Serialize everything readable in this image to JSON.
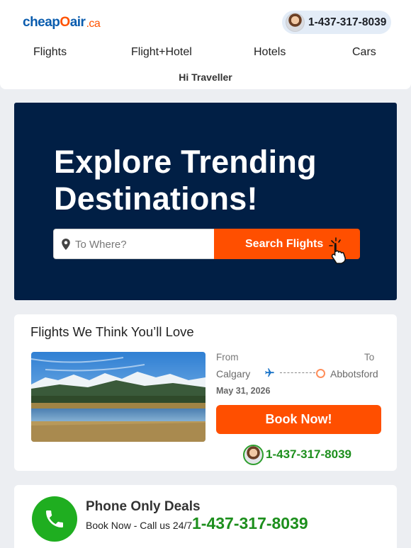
{
  "header": {
    "logo": {
      "part1": "cheap",
      "part2": "O",
      "part3": "air",
      "suffix": ".ca"
    },
    "phone": "1-437-317-8039",
    "nav": [
      "Flights",
      "Flight+Hotel",
      "Hotels",
      "Cars"
    ],
    "greeting": "Hi Traveller"
  },
  "hero": {
    "title": "Explore Trending Destinations!",
    "search_placeholder": "To Where?",
    "search_button": "Search Flights"
  },
  "deal_card": {
    "title": "Flights We Think You’ll Love",
    "from_label": "From",
    "to_label": "To",
    "origin": "Calgary",
    "destination": "Abbotsford",
    "date": "May 31, 2026",
    "book_button": "Book Now!",
    "phone": "1-437-317-8039"
  },
  "phone_deals": {
    "title": "Phone Only Deals",
    "subtitle": "Book Now - Call us 24/7",
    "phone": "1-437-317-8039"
  },
  "colors": {
    "brand_blue": "#0a5cae",
    "accent_orange": "#ff4f00",
    "hero_bg": "#011f45",
    "phone_green": "#1d8f1d"
  }
}
